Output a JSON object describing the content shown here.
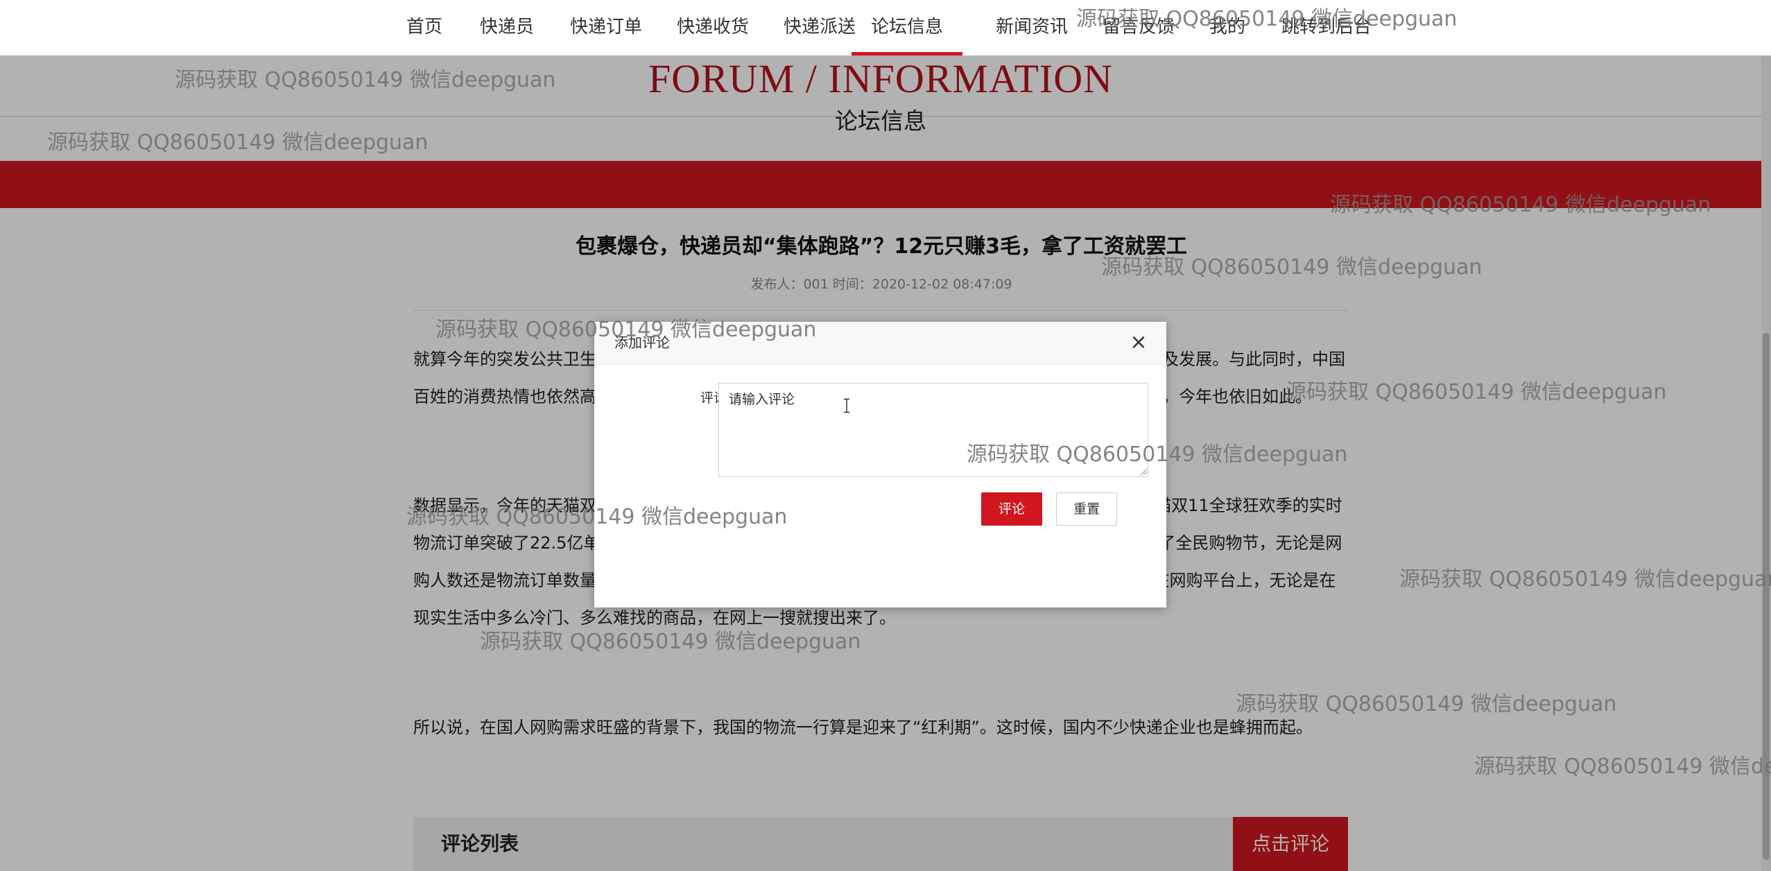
{
  "nav": {
    "items": [
      {
        "label": "首页",
        "active": false
      },
      {
        "label": "快递员",
        "active": false
      },
      {
        "label": "快递订单",
        "active": false
      },
      {
        "label": "快递收货",
        "active": false
      },
      {
        "label": "快递派送",
        "active": false
      },
      {
        "label": "论坛信息",
        "active": true
      },
      {
        "label": "新闻资讯",
        "active": false
      },
      {
        "label": "留言反馈",
        "active": false
      },
      {
        "label": "我的",
        "active": false
      },
      {
        "label": "跳转到后台",
        "active": false
      }
    ]
  },
  "header": {
    "english_title": "FORUM / INFORMATION",
    "chinese_title": "论坛信息"
  },
  "article": {
    "title": "包裹爆仓，快递员却“集体跑路”？12元只赚3毛，拿了工资就罢工",
    "meta_label": "发布人：001 时间：",
    "meta_time": "2020-12-02 08:47:09",
    "paragraphs": [
      "就算今年的突发公共卫生事件让世界各国的经济都遭受了不小的打击，但我国的经济依旧在稳步恢复以及发展。与此同时，中国百姓的消费热情也依然高涨，每年双十一，中国百姓的购买力以及物流能力都让国外媒体感到非常吃惊，今年也依旧如此。",
      "数据显示，今年的天猫双十一期间，物流订单量创下了新纪录。据菜鸟官方数据，截至11月11日，天猫双11全球狂欢季的实时物流订单突破了22.5亿单。以前的11月11日在人们眼里也就是“光棍节”而已，现在的双十一已经成为了全民购物节，无论是网购人数还是物流订单数量，都是肉眼可见的多!这也很正常，毕竟，中国算是网购“最疯狂”的国家了，在网购平台上，无论是在现实生活中多么冷门、多么难找的商品，在网上一搜就搜出来了。",
      "所以说，在国人网购需求旺盛的背景下，我国的物流一行算是迎来了“红利期”。这时候，国内不少快递企业也是蜂拥而起。"
    ]
  },
  "comments": {
    "list_title": "评论列表",
    "add_button": "点击评论"
  },
  "modal": {
    "title": "添加评论",
    "close_symbol": "×",
    "field_label": "评论：",
    "input_value": "请输入评论",
    "submit_label": "评论",
    "reset_label": "重置"
  },
  "watermark": {
    "text": "源码获取 QQ86050149 微信deepguan"
  },
  "colors": {
    "accent": "#d0171f",
    "title_red": "#b3141b",
    "overlay": "rgba(0,0,0,0.30)"
  }
}
